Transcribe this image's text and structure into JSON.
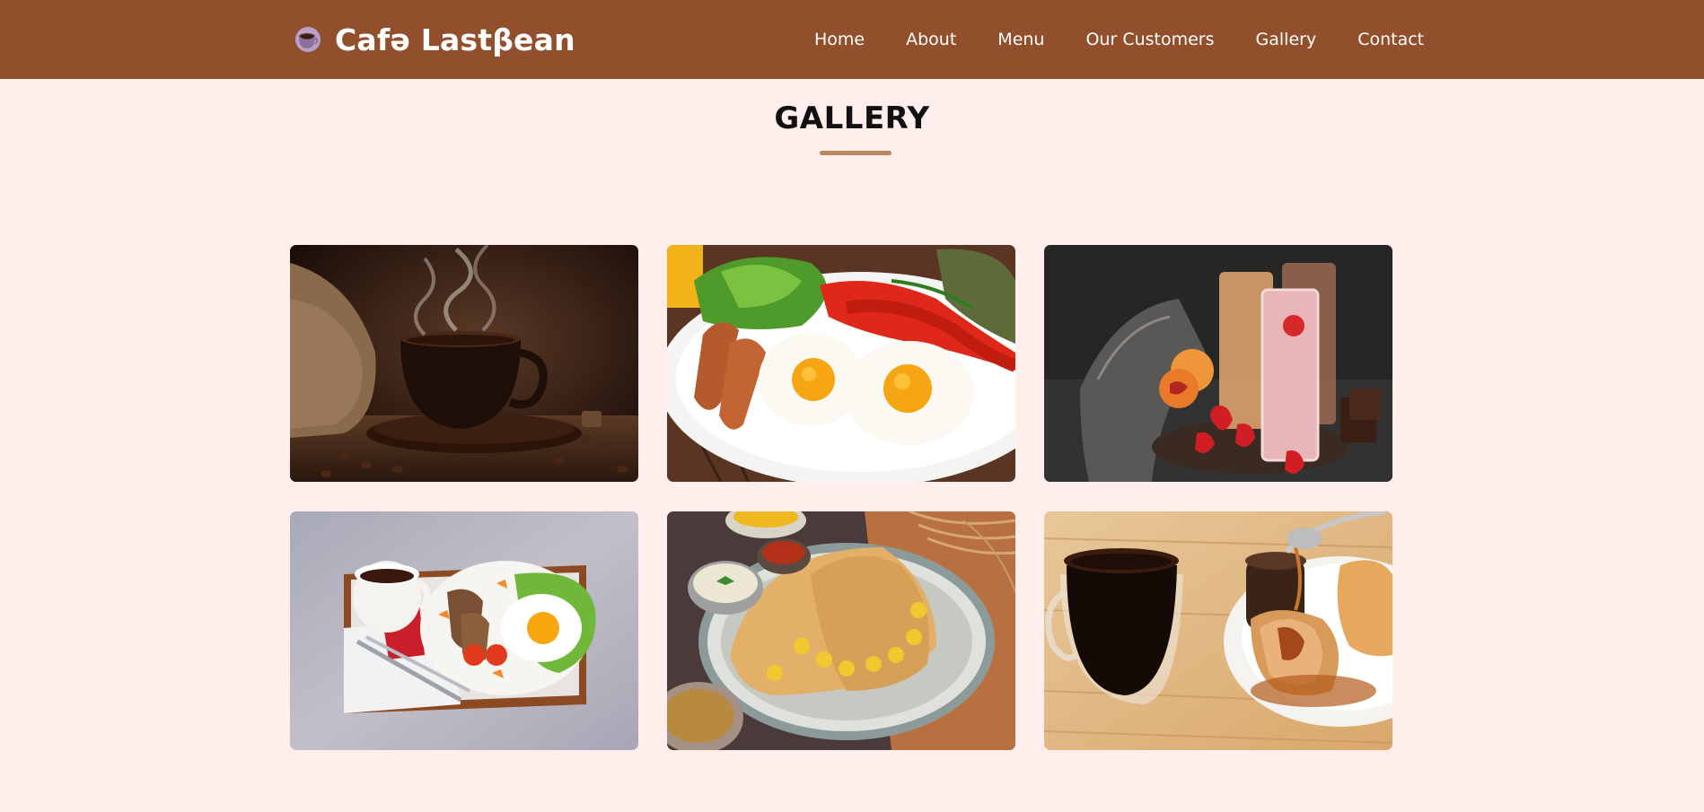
{
  "brand": {
    "name": "Cafə Lastβean",
    "icon": "coffee-cup-icon"
  },
  "nav": {
    "items": [
      {
        "label": "Home"
      },
      {
        "label": "About"
      },
      {
        "label": "Menu"
      },
      {
        "label": "Our Customers"
      },
      {
        "label": "Gallery"
      },
      {
        "label": "Contact"
      }
    ]
  },
  "gallery": {
    "title": "GALLERY",
    "accent_color": "#b8895a",
    "images": [
      {
        "subject": "coffee-cup-steam-photo"
      },
      {
        "subject": "fried-eggs-sausage-breakfast-photo"
      },
      {
        "subject": "smoothies-strawberries-photo"
      },
      {
        "subject": "breakfast-tray-egg-toast-photo"
      },
      {
        "subject": "dosa-plate-photo"
      },
      {
        "subject": "coffee-croissant-honey-photo"
      }
    ]
  },
  "colors": {
    "header_bg": "#924f2b",
    "page_bg": "#ffeeec",
    "header_text": "#ffffff"
  }
}
